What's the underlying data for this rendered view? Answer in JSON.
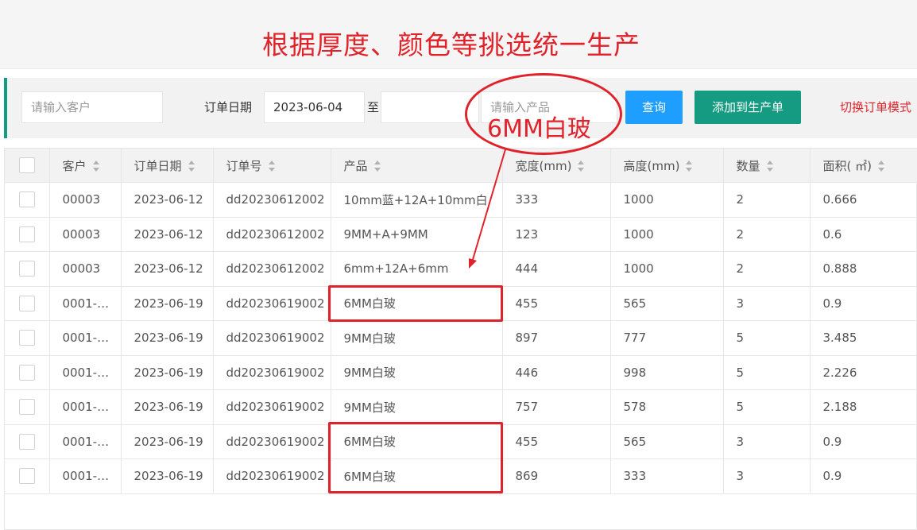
{
  "banner": {
    "title": "根据厚度、颜色等挑选统一生产"
  },
  "toolbar": {
    "customer_placeholder": "请输入客户",
    "date_label": "订单日期",
    "date_from": "2023-06-04",
    "to_label": "至",
    "date_to": "",
    "product_placeholder": "请输入产品",
    "query_button": "查询",
    "add_button": "添加到生产单",
    "switch_link": "切换订单模式"
  },
  "table": {
    "columns": [
      "客户",
      "订单日期",
      "订单号",
      "产品",
      "宽度(mm)",
      "高度(mm)",
      "数量",
      "面积( ㎡)"
    ],
    "rows": [
      [
        "00003",
        "2023-06-12",
        "dd20230612002",
        "10mm蓝+12A+10mm白",
        "333",
        "1000",
        "2",
        "0.666"
      ],
      [
        "00003",
        "2023-06-12",
        "dd20230612002",
        "9MM+A+9MM",
        "123",
        "1000",
        "2",
        "0.6"
      ],
      [
        "00003",
        "2023-06-12",
        "dd20230612002",
        "6mm+12A+6mm",
        "444",
        "1000",
        "2",
        "0.888"
      ],
      [
        "0001-…",
        "2023-06-19",
        "dd20230619002",
        "6MM白玻",
        "455",
        "565",
        "3",
        "0.9"
      ],
      [
        "0001-…",
        "2023-06-19",
        "dd20230619002",
        "9MM白玻",
        "897",
        "777",
        "5",
        "3.485"
      ],
      [
        "0001-…",
        "2023-06-19",
        "dd20230619002",
        "9MM白玻",
        "446",
        "998",
        "5",
        "2.226"
      ],
      [
        "0001-…",
        "2023-06-19",
        "dd20230619002",
        "9MM白玻",
        "757",
        "578",
        "5",
        "2.188"
      ],
      [
        "0001-…",
        "2023-06-19",
        "dd20230619002",
        "6MM白玻",
        "455",
        "565",
        "3",
        "0.9"
      ],
      [
        "0001-…",
        "2023-06-19",
        "dd20230619002",
        "6MM白玻",
        "869",
        "333",
        "3",
        "0.9"
      ]
    ]
  },
  "annotation": {
    "text": "6MM白玻"
  },
  "colors": {
    "accent_green": "#159b82",
    "button_blue": "#1e9fff",
    "annotation_red": "#e0232b"
  }
}
